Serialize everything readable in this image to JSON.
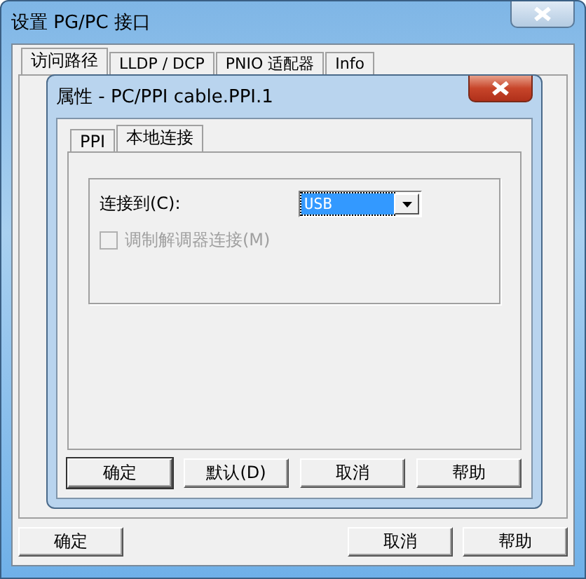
{
  "window": {
    "title": "设置 PG/PC 接口"
  },
  "tabs": [
    {
      "label": "访问路径",
      "selected": true
    },
    {
      "label": "LLDP / DCP",
      "selected": false
    },
    {
      "label": "PNIO 适配器",
      "selected": false
    },
    {
      "label": "Info",
      "selected": false
    }
  ],
  "buttons": [
    "确定",
    "取消",
    "帮助"
  ],
  "dialog": {
    "title": "属性 - PC/PPI cable.PPI.1",
    "tabs": [
      {
        "label": "PPI",
        "selected": false
      },
      {
        "label": "本地连接",
        "selected": true
      }
    ],
    "connect_label": "连接到(C):",
    "connect_value": "USB",
    "modem": {
      "label": "调制解调器连接(M)",
      "checked": false,
      "disabled": true
    },
    "buttons": [
      "确定",
      "默认(D)",
      "取消",
      "帮助"
    ]
  }
}
